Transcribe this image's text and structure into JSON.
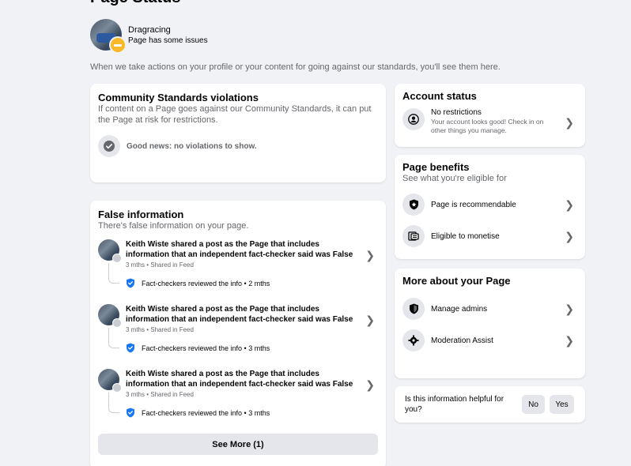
{
  "page_title": "Page Status",
  "profile": {
    "name": "Dragracing",
    "status": "Page has some issues"
  },
  "intro": "When we take actions on your profile or your content for going against our standards, you'll see them here.",
  "community_standards": {
    "title": "Community Standards violations",
    "subtitle": "If content on a Page goes against our Community Standards, it can put the Page at risk for restrictions.",
    "good_news": "Good news: no violations to show."
  },
  "false_info": {
    "title": "False information",
    "subtitle": "There's false information on your page.",
    "items": [
      {
        "text": "Keith Wiste shared a post as the Page that includes information that an independent fact-checker said was False",
        "meta": "3 mths • Shared in Feed",
        "check": "Fact-checkers reviewed the info • 2 mths"
      },
      {
        "text": "Keith Wiste shared a post as the Page that includes information that an independent fact-checker said was False",
        "meta": "3 mths • Shared in Feed",
        "check": "Fact-checkers reviewed the info • 3 mths"
      },
      {
        "text": "Keith Wiste shared a post as the Page that includes information that an independent fact-checker said was False",
        "meta": "3 mths • Shared in Feed",
        "check": "Fact-checkers reviewed the info • 3 mths"
      }
    ],
    "see_more": "See More (1)"
  },
  "account_status": {
    "title": "Account status",
    "item_title": "No restrictions",
    "item_desc": "Your account looks good! Check in on other things you manage."
  },
  "page_benefits": {
    "title": "Page benefits",
    "subtitle": "See what you're eligible for",
    "items": [
      {
        "label": "Page is recommendable",
        "icon": "shield-star-icon"
      },
      {
        "label": "Eligible to monetise",
        "icon": "money-icon"
      }
    ]
  },
  "more_about": {
    "title": "More about your Page",
    "items": [
      {
        "label": "Manage admins",
        "icon": "shield-icon"
      },
      {
        "label": "Moderation Assist",
        "icon": "gear-icon"
      }
    ]
  },
  "helpful": {
    "question": "Is this information helpful for you?",
    "no": "No",
    "yes": "Yes"
  },
  "colors": {
    "background": "#f0f2f5",
    "warning": "#f7b928",
    "fact_check_blue": "#1877f2"
  }
}
